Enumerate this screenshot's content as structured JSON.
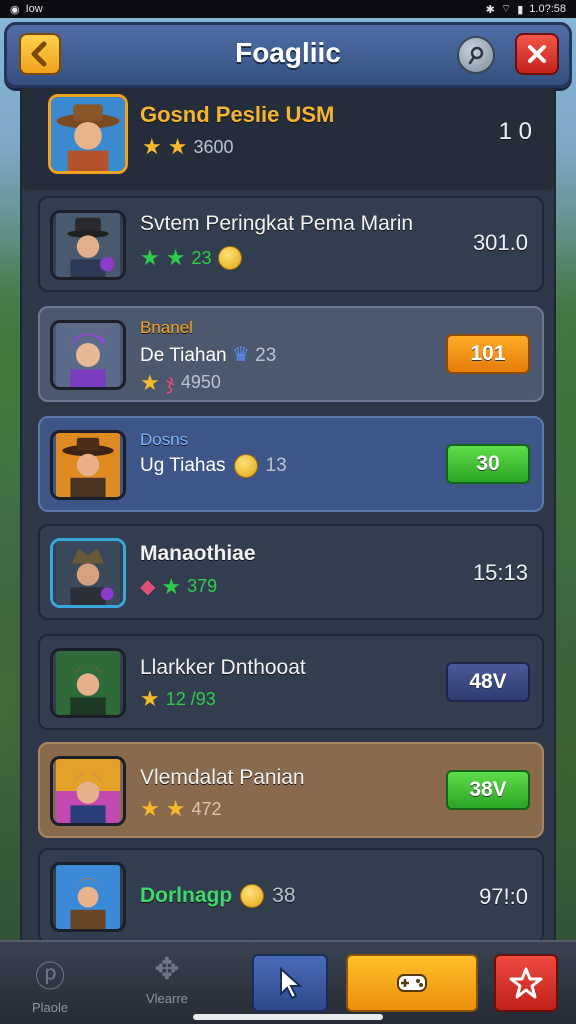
{
  "status_bar": {
    "left_text": "Iow",
    "right_text": "1.0?:58"
  },
  "header": {
    "title": "Foagliic",
    "back_icon": "chevron-left-icon",
    "help_icon": "help-icon",
    "close_icon": "close-x-icon"
  },
  "leaderboard": [
    {
      "name": "Gosnd Peslie USM",
      "stars": [
        "gold",
        "gold"
      ],
      "stat_text": "3600",
      "score": "1 0",
      "style": "first"
    },
    {
      "name": "Svtem Peringkat Pema Marin",
      "stars": [
        "green",
        "green"
      ],
      "stat_text": "23",
      "has_coin": true,
      "score": "301.0",
      "style": "plain"
    },
    {
      "name": "Bnanel",
      "sub_text": "De Tiahan",
      "sub_stat": "23",
      "stars": [
        "gold"
      ],
      "stat_text": "4950",
      "score": "101",
      "style": "hl-grey",
      "button_color": "orange"
    },
    {
      "name": "Dosns",
      "sub_text": "Ug Tiahas",
      "sub_stat": "13",
      "score": "30",
      "style": "hl-blue",
      "button_color": "green"
    },
    {
      "name": "Manaothiae",
      "stars": [
        "green"
      ],
      "stat_text": "379",
      "score": "15:13",
      "style": "plain"
    },
    {
      "name": "Llarkker Dnthooat",
      "stars": [
        "gold"
      ],
      "stat_text": "12 /93",
      "score": "48V",
      "style": "plain",
      "button_color": "navy"
    },
    {
      "name": "Vlemdalat Panian",
      "stars": [
        "gold",
        "gold"
      ],
      "stat_text": "472",
      "score": "38V",
      "style": "hl-brown",
      "button_color": "green"
    },
    {
      "name": "Dorlnagp",
      "stat_text": "38",
      "has_coin": true,
      "score": "97!:0",
      "style": "plain"
    }
  ],
  "bottom_nav": {
    "items": [
      {
        "label": "Plaole",
        "icon": "pin-icon"
      },
      {
        "label": "Vlearre",
        "icon": "cards-icon"
      }
    ],
    "actions": [
      {
        "icon": "cursor-icon",
        "color": "#3b5ba0"
      },
      {
        "icon": "gamepad-icon",
        "color": "#f5a623"
      },
      {
        "icon": "star-icon",
        "color": "#d9322c"
      }
    ]
  }
}
